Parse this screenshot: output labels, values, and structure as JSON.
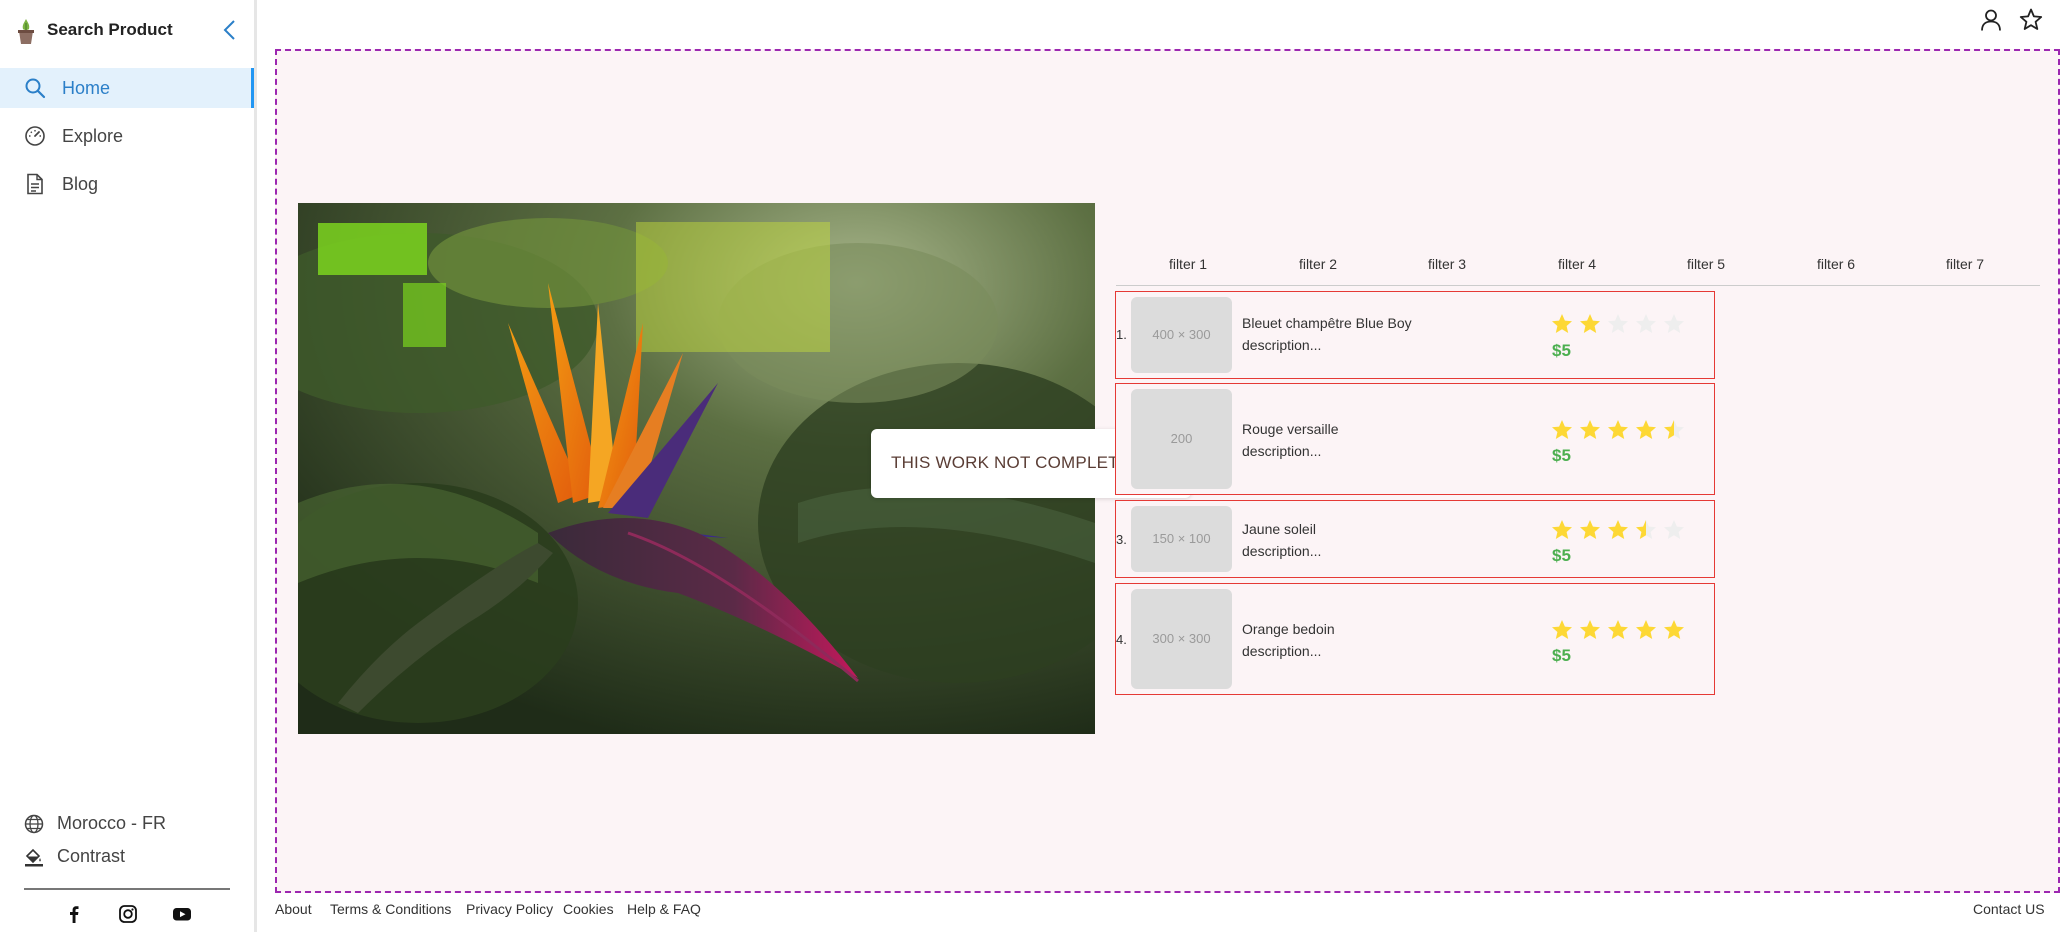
{
  "app": {
    "title": "Search Product"
  },
  "sidebar": {
    "items": [
      {
        "label": "Home",
        "icon": "search-icon",
        "active": true
      },
      {
        "label": "Explore",
        "icon": "gauge-icon",
        "active": false
      },
      {
        "label": "Blog",
        "icon": "document-icon",
        "active": false
      }
    ],
    "region": "Morocco - FR",
    "contrast": "Contrast",
    "social": [
      "facebook-icon",
      "instagram-icon",
      "youtube-icon"
    ]
  },
  "topbar": {
    "icons": [
      "user-icon",
      "star-icon"
    ]
  },
  "notice": "THIS WORK NOT COMPLETED YET",
  "filters": [
    "filter 1",
    "filter 2",
    "filter 3",
    "filter 4",
    "filter 5",
    "filter 6",
    "filter 7"
  ],
  "products": [
    {
      "num": "1.",
      "thumb": "400 × 300",
      "name": "Bleuet champêtre Blue Boy",
      "desc": "description...",
      "rating": 2,
      "price": "$5"
    },
    {
      "num": "",
      "thumb": "200",
      "name": "Rouge versaille",
      "desc": "description...",
      "rating": 4.5,
      "price": "$5"
    },
    {
      "num": "3.",
      "thumb": "150 × 100",
      "name": "Jaune soleil",
      "desc": "description...",
      "rating": 3.5,
      "price": "$5"
    },
    {
      "num": "4.",
      "thumb": "300 × 300",
      "name": "Orange bedoin",
      "desc": "description...",
      "rating": 5,
      "price": "$5"
    }
  ],
  "footer": {
    "links": [
      "About",
      "Terms & Conditions",
      "Privacy Policy",
      "Cookies",
      "Help & FAQ"
    ],
    "contact": "Contact US"
  },
  "colors": {
    "accent": "#2196f3",
    "price": "#4caf50",
    "card_border": "#e53935",
    "dashed_border": "#9c27b0",
    "star_on": "#fdd835",
    "star_off": "#eeeeee"
  }
}
